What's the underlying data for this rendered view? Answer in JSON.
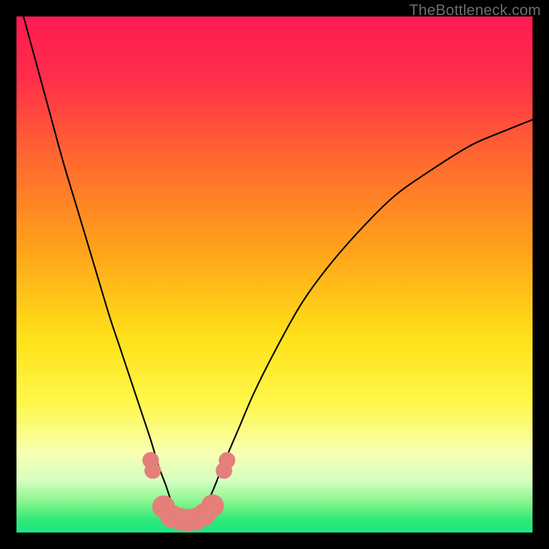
{
  "watermark": "TheBottleneck.com",
  "gradient": {
    "stops": [
      {
        "offset": 0.0,
        "color": "#ff1a53"
      },
      {
        "offset": 0.12,
        "color": "#ff2e4a"
      },
      {
        "offset": 0.28,
        "color": "#ff6a2f"
      },
      {
        "offset": 0.45,
        "color": "#ffa21a"
      },
      {
        "offset": 0.62,
        "color": "#ffe019"
      },
      {
        "offset": 0.75,
        "color": "#fff84a"
      },
      {
        "offset": 0.85,
        "color": "#f7ffb6"
      },
      {
        "offset": 0.9,
        "color": "#d4ffc0"
      },
      {
        "offset": 0.94,
        "color": "#8af590"
      },
      {
        "offset": 0.975,
        "color": "#30e977"
      },
      {
        "offset": 1.0,
        "color": "#1de586"
      }
    ]
  },
  "chart_data": {
    "type": "line",
    "title": "",
    "xlabel": "",
    "ylabel": "",
    "xlim": [
      0,
      100
    ],
    "ylim": [
      0,
      100
    ],
    "series": [
      {
        "name": "curve",
        "x": [
          0,
          3,
          6,
          9,
          12,
          15,
          18,
          20,
          22,
          24,
          26,
          27.5,
          29,
          30,
          31,
          32,
          33,
          34,
          35,
          36,
          38,
          40,
          43,
          46,
          50,
          55,
          60,
          66,
          73,
          80,
          88,
          95,
          100
        ],
        "y": [
          105,
          94,
          83,
          72,
          62,
          52,
          42,
          36,
          30,
          24,
          18,
          13,
          9,
          6,
          4,
          2.5,
          2,
          2,
          2.5,
          4,
          8,
          13,
          20,
          27,
          35,
          44,
          51,
          58,
          65,
          70,
          75,
          78,
          80
        ]
      }
    ],
    "markers": {
      "name": "beads",
      "points": [
        {
          "x": 26.0,
          "y": 14.0,
          "r": 1.6
        },
        {
          "x": 26.4,
          "y": 12.0,
          "r": 1.6
        },
        {
          "x": 28.5,
          "y": 5.0,
          "r": 2.2
        },
        {
          "x": 30.0,
          "y": 3.2,
          "r": 2.2
        },
        {
          "x": 31.6,
          "y": 2.6,
          "r": 2.2
        },
        {
          "x": 33.2,
          "y": 2.4,
          "r": 2.2
        },
        {
          "x": 34.8,
          "y": 2.6,
          "r": 2.2
        },
        {
          "x": 36.4,
          "y": 3.5,
          "r": 2.2
        },
        {
          "x": 38.0,
          "y": 5.2,
          "r": 2.2
        },
        {
          "x": 40.2,
          "y": 12.0,
          "r": 1.6
        },
        {
          "x": 40.8,
          "y": 14.0,
          "r": 1.6
        }
      ],
      "color": "#e47f7a"
    }
  }
}
